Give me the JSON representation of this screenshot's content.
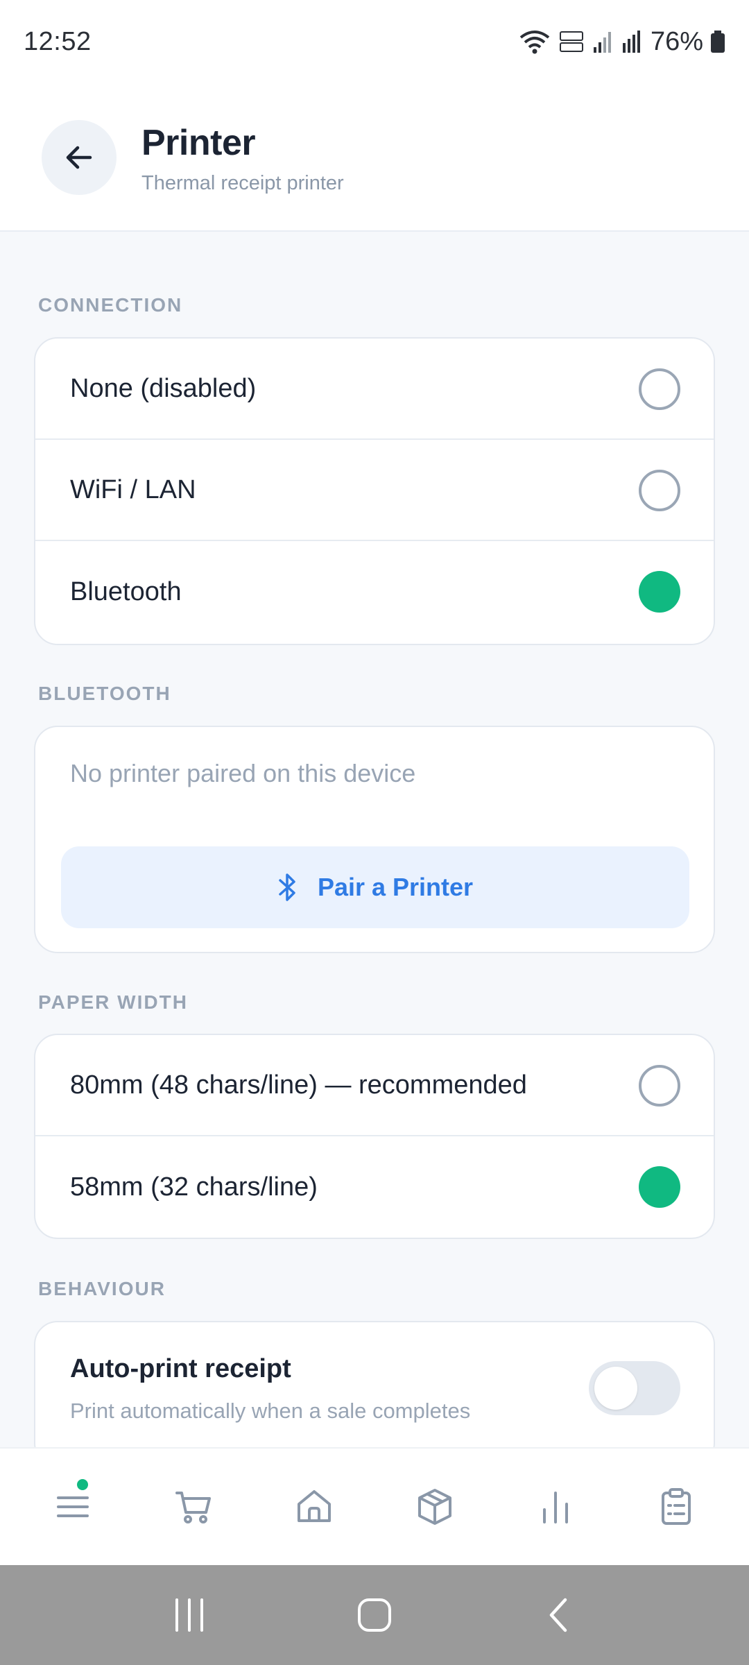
{
  "status_bar": {
    "time": "12:52",
    "battery": "76%"
  },
  "header": {
    "title": "Printer",
    "subtitle": "Thermal receipt printer"
  },
  "connection": {
    "label": "CONNECTION",
    "options": [
      {
        "label": "None (disabled)",
        "selected": false
      },
      {
        "label": "WiFi / LAN",
        "selected": false
      },
      {
        "label": "Bluetooth",
        "selected": true
      }
    ]
  },
  "bluetooth": {
    "label": "BLUETOOTH",
    "empty_text": "No printer paired on this device",
    "pair_button": "Pair a Printer"
  },
  "paper_width": {
    "label": "PAPER WIDTH",
    "options": [
      {
        "label": "80mm (48 chars/line) — recommended",
        "selected": false
      },
      {
        "label": "58mm (32 chars/line)",
        "selected": true
      }
    ]
  },
  "behaviour": {
    "label": "BEHAVIOUR",
    "auto_print_title": "Auto-print receipt",
    "auto_print_subtitle": "Print automatically when a sale completes",
    "auto_print_enabled": false
  },
  "tabbar": {
    "icons": [
      "menu-icon",
      "cart-icon",
      "home-icon",
      "box-icon",
      "chart-icon",
      "clipboard-icon"
    ]
  },
  "colors": {
    "accent": "#10b981",
    "link": "#2f7be4",
    "text": "#1c2433",
    "muted": "#98a4b4"
  }
}
